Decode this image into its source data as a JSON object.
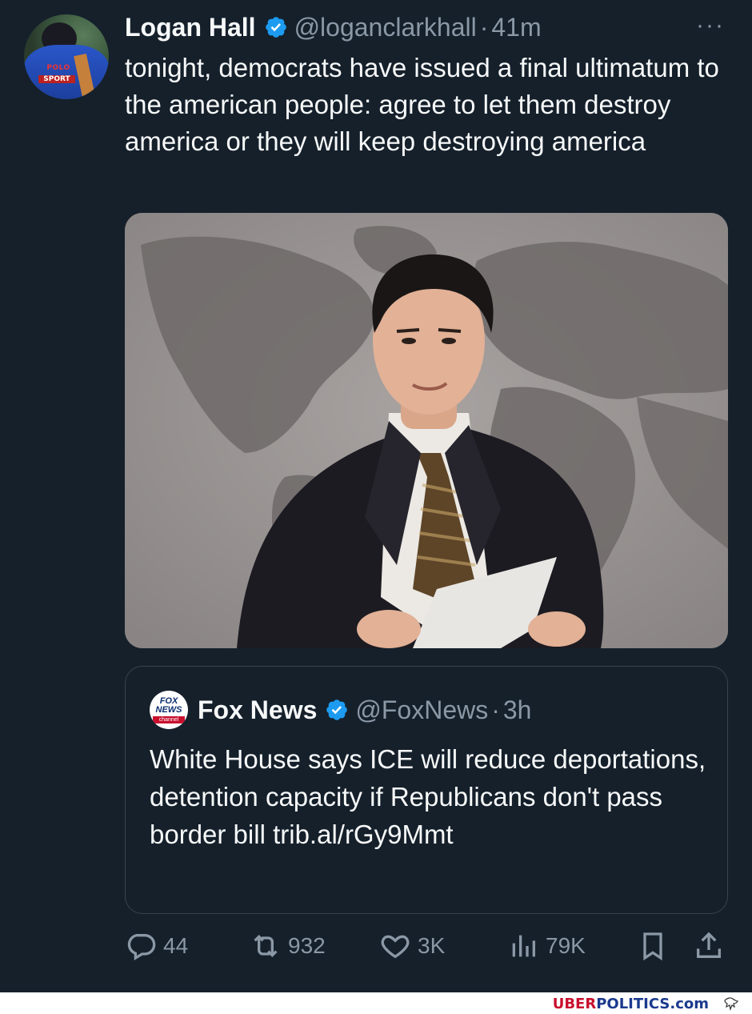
{
  "tweet": {
    "author_name": "Logan Hall",
    "handle": "@loganclarkhall",
    "separator": "·",
    "time": "41m",
    "more_label": "···",
    "text": "tonight, democrats have issued a final ultimatum to the american people: agree to let them destroy america or they will keep destroying america",
    "avatar_text_1": "POLO",
    "avatar_text_2": "SPORT"
  },
  "quoted": {
    "author_name": "Fox News",
    "handle": "@FoxNews",
    "separator": "·",
    "time": "3h",
    "logo_text_1": "FOX",
    "logo_text_2": "NEWS",
    "logo_text_3": "channel",
    "text": "White House says ICE will reduce deportations, detention capacity if Republicans don't pass border bill trib.al/rGy9Mmt"
  },
  "actions": {
    "replies": "44",
    "reposts": "932",
    "likes": "3K",
    "views": "79K"
  },
  "watermark": {
    "part1": "UBER",
    "part2": "POLITICS",
    "part3": ".com"
  },
  "colors": {
    "background": "#15202b",
    "text": "#f7f9f9",
    "secondary": "#8b98a5",
    "verified": "#1d9bf0",
    "border": "#38444d"
  }
}
